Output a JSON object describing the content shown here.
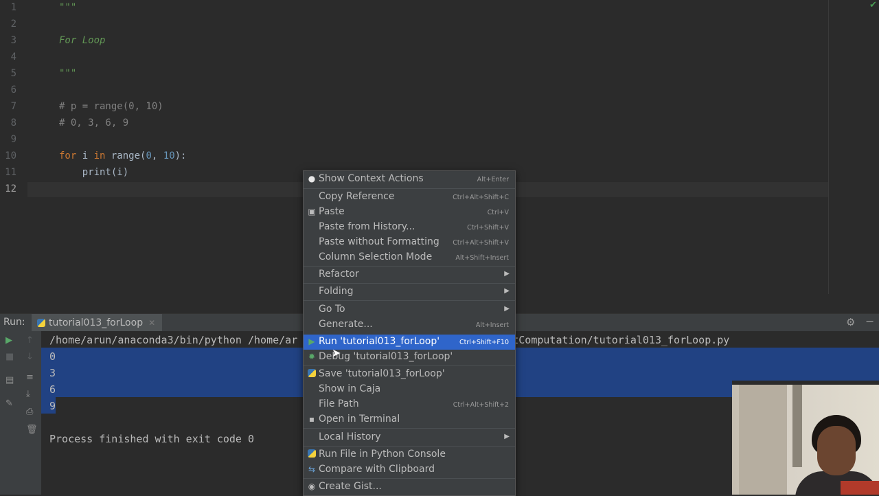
{
  "editor": {
    "lines": [
      {
        "num": "1",
        "text": "\"\"\""
      },
      {
        "num": "2",
        "text": ""
      },
      {
        "num": "3",
        "text": "For Loop"
      },
      {
        "num": "4",
        "text": ""
      },
      {
        "num": "5",
        "text": "\"\"\""
      },
      {
        "num": "6",
        "text": ""
      },
      {
        "num": "7",
        "text": "# p = range(0, 10)"
      },
      {
        "num": "8",
        "text": "# 0, 3, 6, 9"
      },
      {
        "num": "9",
        "text": ""
      },
      {
        "num": "10",
        "text": "for i in range(0, 10):"
      },
      {
        "num": "11",
        "text": "    print(i)"
      },
      {
        "num": "12",
        "text": ""
      }
    ],
    "code_parts": {
      "for_kw": "for",
      "i_in": " i ",
      "in_kw": "in",
      "range_open": " range(",
      "zero": "0",
      "comma": ", ",
      "ten": "10",
      "close": "):",
      "print_line": "    print(i)"
    }
  },
  "run_panel": {
    "label": "Run:",
    "tab_name": "tutorial013_forLoop",
    "command_left": "/home/arun/anaconda3/bin/python /home/ar",
    "command_right": "tComputation/tutorial013_forLoop.py",
    "output": [
      "0",
      "3",
      "6",
      "9"
    ],
    "exit_message": "Process finished with exit code 0"
  },
  "context_menu": {
    "items": [
      {
        "label": "Show Context Actions",
        "shortcut": "Alt+Enter",
        "icon": "bulb-icon"
      },
      {
        "label": "Copy Reference",
        "shortcut": "Ctrl+Alt+Shift+C"
      },
      {
        "label": "Paste",
        "shortcut": "Ctrl+V",
        "icon": "clipboard-icon"
      },
      {
        "label": "Paste from History...",
        "shortcut": "Ctrl+Shift+V"
      },
      {
        "label": "Paste without Formatting",
        "shortcut": "Ctrl+Alt+Shift+V"
      },
      {
        "label": "Column Selection Mode",
        "shortcut": "Alt+Shift+Insert"
      },
      {
        "label": "Refactor",
        "shortcut": "",
        "submenu": true
      },
      {
        "label": "Folding",
        "shortcut": "",
        "submenu": true
      },
      {
        "label": "Go To",
        "shortcut": "",
        "submenu": true
      },
      {
        "label": "Generate...",
        "shortcut": "Alt+Insert"
      },
      {
        "label": "Run 'tutorial013_forLoop'",
        "shortcut": "Ctrl+Shift+F10",
        "icon": "run-icon",
        "highlighted": true
      },
      {
        "label": "Debug 'tutorial013_forLoop'",
        "shortcut": "",
        "icon": "debug-icon"
      },
      {
        "label": "Save 'tutorial013_forLoop'",
        "shortcut": "",
        "icon": "python-icon"
      },
      {
        "label": "Show in Caja",
        "shortcut": ""
      },
      {
        "label": "File Path",
        "shortcut": "Ctrl+Alt+Shift+2"
      },
      {
        "label": "Open in Terminal",
        "shortcut": "",
        "icon": "terminal-icon"
      },
      {
        "label": "Local History",
        "shortcut": "",
        "submenu": true
      },
      {
        "label": "Run File in Python Console",
        "shortcut": "",
        "icon": "python-icon"
      },
      {
        "label": "Compare with Clipboard",
        "shortcut": "",
        "icon": "compare-icon"
      },
      {
        "label": "Create Gist...",
        "shortcut": "",
        "icon": "github-icon"
      }
    ]
  },
  "colors": {
    "editor_bg": "#2b2b2b",
    "menu_bg": "#3c3f41",
    "highlight": "#2f65ca",
    "selection": "#214283",
    "keyword": "#cc7832",
    "number": "#6897bb",
    "docstring": "#629755",
    "comment": "#808080"
  }
}
